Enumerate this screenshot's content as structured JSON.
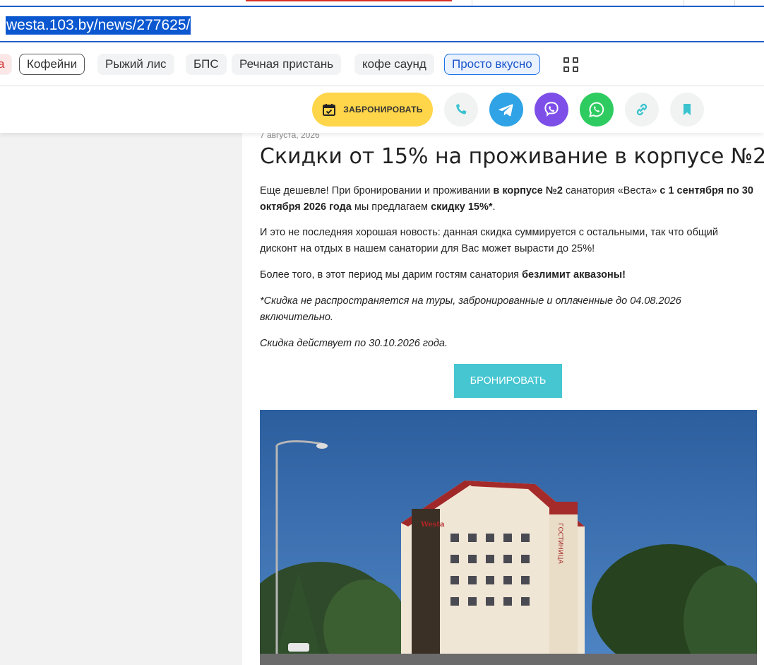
{
  "browser": {
    "url": "westa.103.by/news/277625/"
  },
  "chips": [
    {
      "label": "а",
      "style": "partial"
    },
    {
      "label": "Кофейни",
      "style": "outlined"
    },
    {
      "label": "Рыжий лис",
      "style": "plain"
    },
    {
      "label": "БПС",
      "style": "plain"
    },
    {
      "label": "Речная пристань",
      "style": "plain"
    },
    {
      "label": "кофе саунд",
      "style": "plain"
    },
    {
      "label": "Просто вкусно",
      "style": "active"
    }
  ],
  "actionbar": {
    "book_label": "ЗАБРОНИРОВАТЬ",
    "book_color": "#ffd54a",
    "icons": [
      "phone-icon",
      "telegram-icon",
      "viber-icon",
      "whatsapp-icon",
      "link-icon",
      "bookmark-icon"
    ],
    "colors": {
      "telegram": "#2fa3e6",
      "viber": "#7d4fe8",
      "whatsapp": "#2ecc60",
      "accent": "#3ac3cf"
    }
  },
  "article": {
    "date": "7 августа, 2026",
    "title": "Скидки от 15% на проживание в корпусе №2",
    "p1": {
      "t1": "Еще дешевле! При бронировании и проживании ",
      "b1": "в корпусе №2",
      "t2": " санатория «Веста» ",
      "b2": "с 1 сентября по 30 октября 2026 года",
      "t3": " мы предлагаем ",
      "b3": "скидку 15%*",
      "t4": "."
    },
    "p2": "И это не последняя хорошая новость: данная скидка суммируется с остальными, так что общий дисконт на отдых в нашем санатории для Вас может вырасти до 25%!",
    "p3": {
      "t1": "Более того, в этот период мы дарим гостям санатория ",
      "b1": "безлимит аквазоны!"
    },
    "p4": "*Скидка не распространяется на туры, забронированные и оплаченные до 04.08.2026 включительно.",
    "p5": "Скидка действует по 30.10.2026 года.",
    "cta_label": "БРОНИРОВАТЬ",
    "cta_color": "#45c6d1"
  },
  "photo": {
    "sign_vertical": "ГОСТИНИЦА",
    "logo_text": "Westa"
  }
}
